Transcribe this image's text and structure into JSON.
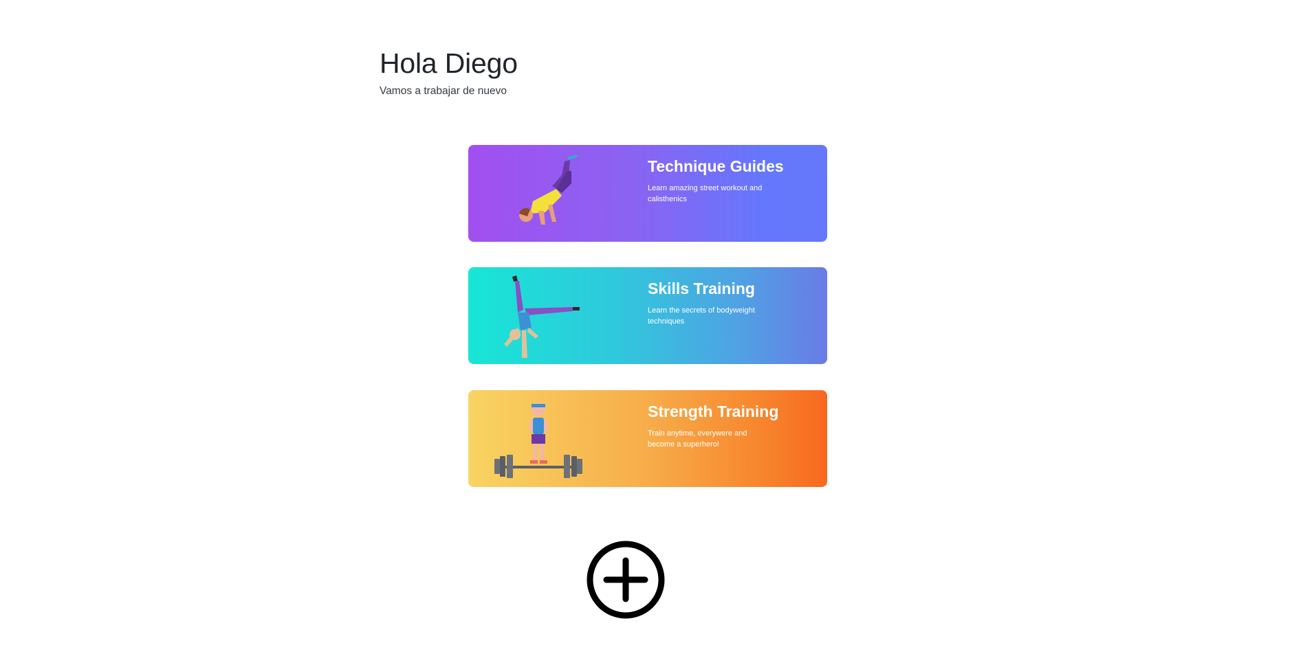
{
  "header": {
    "greeting": "Hola Diego",
    "subtitle": "Vamos a trabajar de nuevo"
  },
  "cards": [
    {
      "title": "Technique Guides",
      "description": "Learn amazing street workout and calisthenics",
      "illustration": "handstand-athlete",
      "colors": [
        "#a24ff0",
        "#6578fc"
      ]
    },
    {
      "title": "Skills Training",
      "description": "Learn the secrets of bodyweight techniques",
      "illustration": "one-arm-handstand-athlete",
      "colors": [
        "#17e6d6",
        "#6a7be6"
      ]
    },
    {
      "title": "Strength Training",
      "description": "Train anytime, everywere and become a superhero!",
      "illustration": "weightlifter-with-barbell",
      "colors": [
        "#f8d462",
        "#f7691e"
      ]
    }
  ],
  "add_button": {
    "icon": "plus-circle-icon"
  }
}
